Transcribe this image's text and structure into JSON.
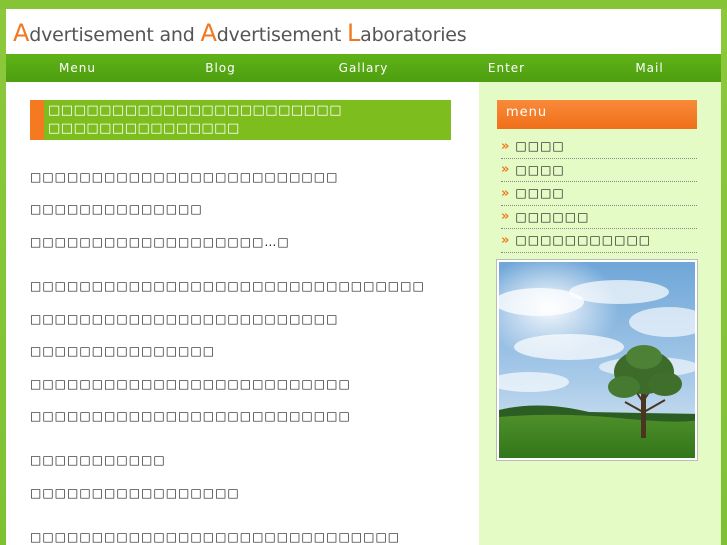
{
  "site": {
    "logo": {
      "parts": [
        {
          "text": "A",
          "cls": "cap orange"
        },
        {
          "text": "dvertisement and ",
          "cls": ""
        },
        {
          "text": "A",
          "cls": "cap orange"
        },
        {
          "text": "dvertisement ",
          "cls": ""
        },
        {
          "text": "L",
          "cls": "cap orange"
        },
        {
          "text": "aboratories",
          "cls": ""
        }
      ]
    }
  },
  "nav": {
    "items": [
      "Menu",
      "Blog",
      "Gallary",
      "Enter",
      "Mail"
    ]
  },
  "main": {
    "title_line1": "□□□□□□□□□□□□□□□□□□□□□□□",
    "title_line2": "□□□□□□□□□□□□□□□",
    "paragraphs": [
      "□□□□□□□□□□□□□□□□□□□□□□□□□",
      "□□□□□□□□□□□□□□",
      "□□□□□□□□□□□□□□□□□□□…□",
      "□□□□□□□□□□□□□□□□□□□□□□□□□□□□□□□□",
      "□□□□□□□□□□□□□□□□□□□□□□□□□",
      "□□□□□□□□□□□□□□□",
      "□□□□□□□□□□□□□□□□□□□□□□□□□□",
      "□□□□□□□□□□□□□□□□□□□□□□□□□□",
      "□□□□□□□□□□□",
      "□□□□□□□□□□□□□□□□□",
      "□□□□□□□□□□□□□□□□□□□□□□□□□□□□□□"
    ]
  },
  "side": {
    "menu_title": "menu",
    "items": [
      "□□□□",
      "□□□□",
      "□□□□",
      "□□□□□□",
      "□□□□□□□□□□□"
    ],
    "chevron": "»"
  },
  "colors": {
    "accent_orange": "#f47921",
    "accent_green": "#7dbd1e",
    "nav_green": "#5fb317",
    "side_bg": "#e4fbc6"
  }
}
